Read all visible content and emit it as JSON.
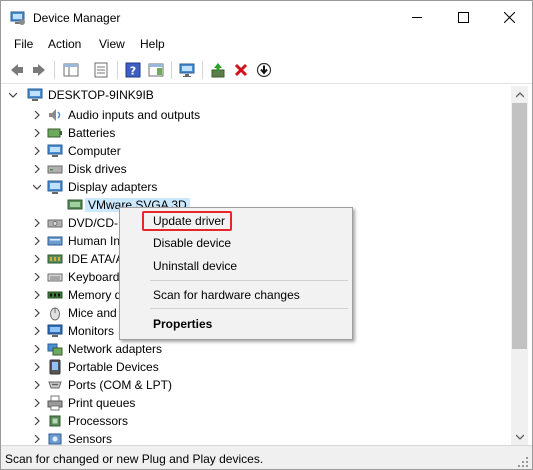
{
  "window": {
    "title": "Device Manager",
    "controls": {
      "minimize": "minimize",
      "maximize": "maximize",
      "close": "close"
    }
  },
  "menu": [
    "File",
    "Action",
    "View",
    "Help"
  ],
  "toolbar": [
    "back-icon",
    "forward-icon",
    "show-hide-console-tree-icon",
    "properties-icon",
    "help-icon",
    "action-pane-icon",
    "computer-monitor-icon",
    "update-driver-icon",
    "uninstall-icon",
    "install-icon"
  ],
  "tree": {
    "root": "DESKTOP-9INK9IB",
    "items": [
      "Audio inputs and outputs",
      "Batteries",
      "Computer",
      "Disk drives",
      "Display adapters",
      "VMware SVGA 3D",
      "DVD/CD-",
      "Human In",
      "IDE ATA/A",
      "Keyboard",
      "Memory d",
      "Mice and",
      "Monitors",
      "Network adapters",
      "Portable Devices",
      "Ports (COM & LPT)",
      "Print queues",
      "Processors",
      "Sensors"
    ]
  },
  "context_menu": {
    "items": [
      "Update driver",
      "Disable device",
      "Uninstall device",
      "Scan for hardware changes",
      "Properties"
    ]
  },
  "status": "Scan for changed or new Plug and Play devices.",
  "colors": {
    "selection": "#cce8ff",
    "highlight": "#e8262a",
    "menu_bg": "#f2f2f2"
  }
}
